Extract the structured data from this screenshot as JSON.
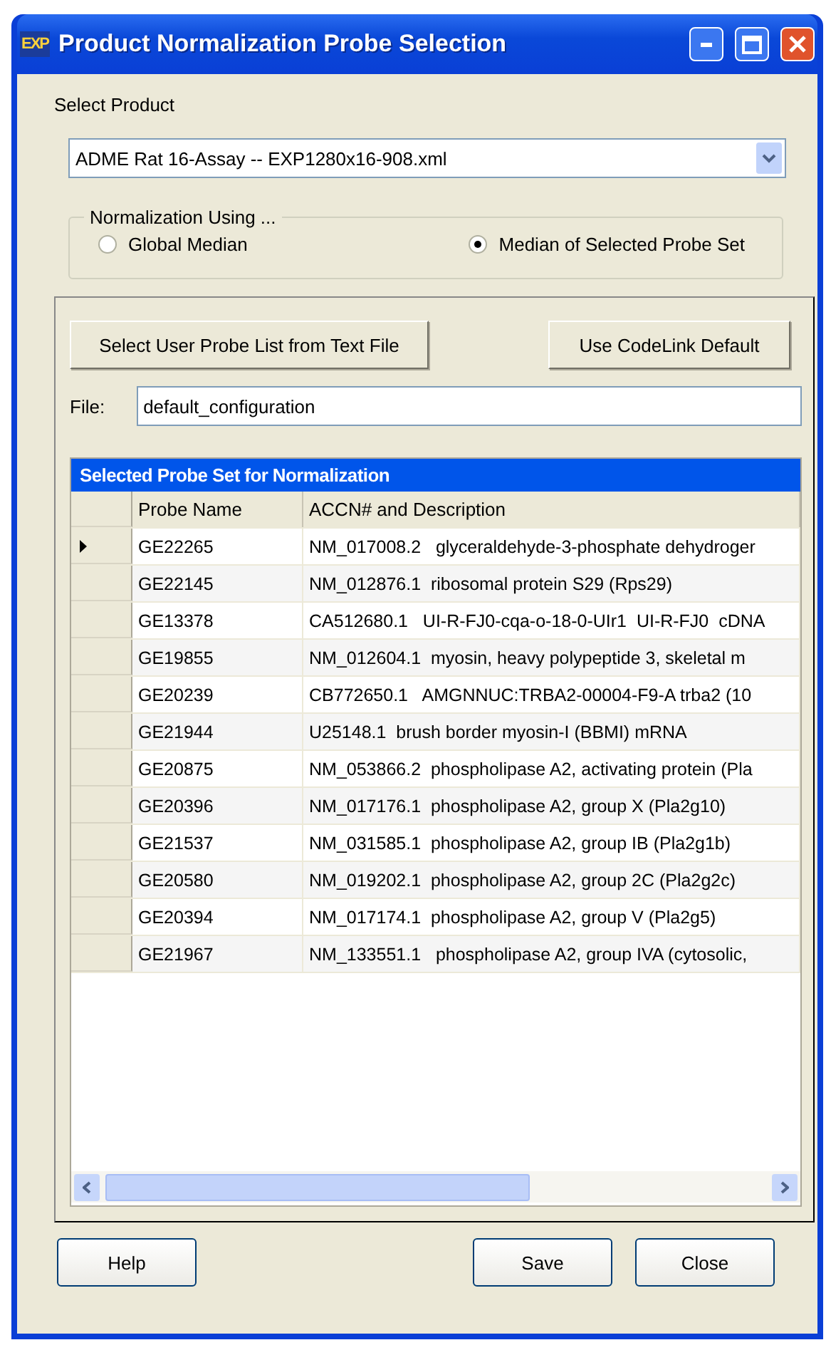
{
  "window": {
    "title": "Product Normalization Probe Selection",
    "app_badge": "EXP"
  },
  "product": {
    "label": "Select Product",
    "value": "ADME Rat 16-Assay -- EXP1280x16-908.xml"
  },
  "normalization": {
    "legend": "Normalization Using ...",
    "options": [
      {
        "label": "Global Median",
        "selected": false
      },
      {
        "label": "Median of Selected Probe Set",
        "selected": true
      }
    ]
  },
  "probe_buttons": [
    "Select User Probe List from Text File",
    "Use CodeLink Default"
  ],
  "file": {
    "label": "File:",
    "value": "default_configuration"
  },
  "table": {
    "title": "Selected Probe Set for Normalization",
    "columns": [
      "Probe Name",
      "ACCN# and Description"
    ],
    "rows": [
      {
        "current": true,
        "cells": [
          "GE22265",
          "NM_017008.2   glyceraldehyde-3-phosphate dehydroger"
        ]
      },
      {
        "current": false,
        "cells": [
          "GE22145",
          "NM_012876.1  ribosomal protein S29 (Rps29)"
        ]
      },
      {
        "current": false,
        "cells": [
          "GE13378",
          "CA512680.1   UI-R-FJ0-cqa-o-18-0-UIr1  UI-R-FJ0  cDNA"
        ]
      },
      {
        "current": false,
        "cells": [
          "GE19855",
          "NM_012604.1  myosin, heavy polypeptide 3, skeletal m"
        ]
      },
      {
        "current": false,
        "cells": [
          "GE20239",
          "CB772650.1   AMGNNUC:TRBA2-00004-F9-A trba2 (10"
        ]
      },
      {
        "current": false,
        "cells": [
          "GE21944",
          "U25148.1  brush border myosin-I (BBMI) mRNA"
        ]
      },
      {
        "current": false,
        "cells": [
          "GE20875",
          "NM_053866.2  phospholipase A2, activating protein (Pla"
        ]
      },
      {
        "current": false,
        "cells": [
          "GE20396",
          "NM_017176.1  phospholipase A2, group X (Pla2g10)"
        ]
      },
      {
        "current": false,
        "cells": [
          "GE21537",
          "NM_031585.1  phospholipase A2, group IB (Pla2g1b)"
        ]
      },
      {
        "current": false,
        "cells": [
          "GE20580",
          "NM_019202.1  phospholipase A2, group 2C (Pla2g2c)"
        ]
      },
      {
        "current": false,
        "cells": [
          "GE20394",
          "NM_017174.1  phospholipase A2, group V (Pla2g5)"
        ]
      },
      {
        "current": false,
        "cells": [
          "GE21967",
          "NM_133551.1   phospholipase A2, group IVA (cytosolic,"
        ]
      }
    ]
  },
  "footer_buttons": [
    {
      "kind": "left",
      "label": "Help"
    },
    {
      "kind": "right",
      "label": "Save"
    },
    {
      "kind": "right",
      "label": "Close"
    }
  ]
}
